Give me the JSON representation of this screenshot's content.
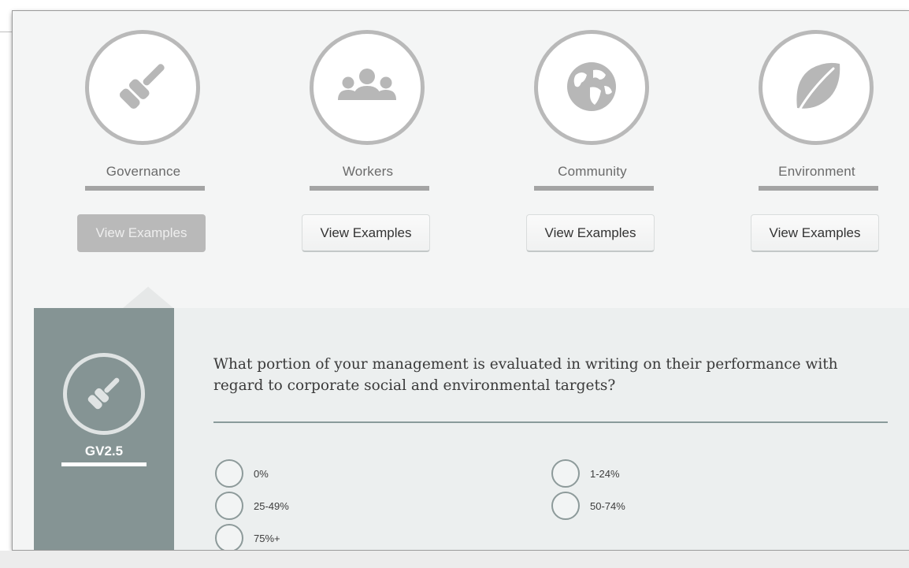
{
  "categories": [
    {
      "label": "Governance",
      "icon": "gavel-icon",
      "button": "View Examples",
      "active": true
    },
    {
      "label": "Workers",
      "icon": "people-icon",
      "button": "View Examples",
      "active": false
    },
    {
      "label": "Community",
      "icon": "globe-icon",
      "button": "View Examples",
      "active": false
    },
    {
      "label": "Environment",
      "icon": "leaf-icon",
      "button": "View Examples",
      "active": false
    }
  ],
  "question": {
    "code": "GV2.5",
    "icon": "gavel-icon",
    "text": "What portion of your management is evaluated in writing on their performance with regard to corporate social and environmental targets?",
    "options": [
      "0%",
      "1-24%",
      "25-49%",
      "50-74%",
      "75%+"
    ]
  },
  "colors": {
    "page_background": "#f4f5f5",
    "icon_gray": "#b9b9b9",
    "active_button": "#b9b9b9",
    "sidebar": "#859494",
    "question_panel": "#ecefef",
    "radio_border": "#8d9a9a"
  }
}
